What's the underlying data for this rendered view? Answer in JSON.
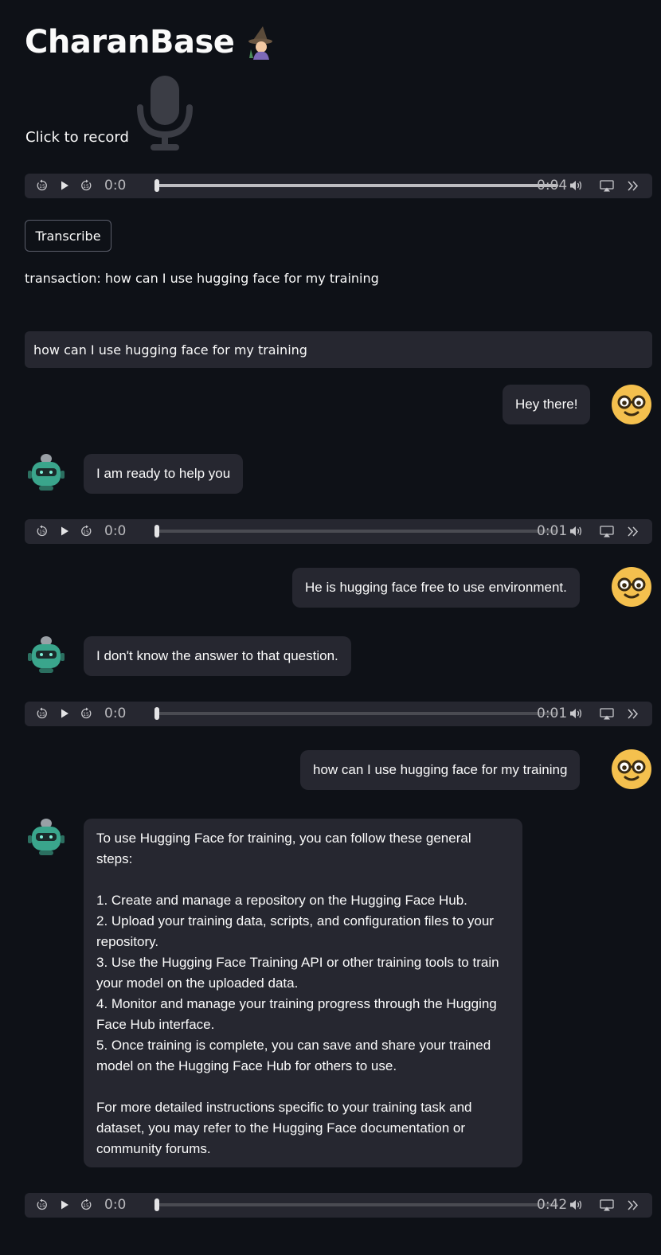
{
  "app": {
    "title": "CharanBase",
    "title_icon": "wizard-emoji-icon"
  },
  "recorder": {
    "label": "Click to record",
    "icon": "microphone-icon"
  },
  "audio_players": [
    {
      "current": "0:0",
      "duration": "0:04",
      "progress": 0.0
    },
    {
      "current": "0:0",
      "duration": "0:01",
      "progress": 0.0
    },
    {
      "current": "0:0",
      "duration": "0:01",
      "progress": 0.0
    },
    {
      "current": "0:0",
      "duration": "0:42",
      "progress": 0.0
    }
  ],
  "transcribe_button": {
    "label": "Transcribe"
  },
  "transcription": "transaction: how can I use hugging face for my training",
  "chat_input": {
    "value": "how can I use hugging face for my training"
  },
  "messages": [
    {
      "role": "user",
      "text": "Hey there!"
    },
    {
      "role": "assistant",
      "text": "I am ready to help you"
    },
    {
      "role": "user",
      "text": "He is hugging face free to use environment."
    },
    {
      "role": "assistant",
      "text": "I don't know the answer to that question."
    },
    {
      "role": "user",
      "text": "how can I use hugging face for my training"
    },
    {
      "role": "assistant",
      "text": "To use Hugging Face for training, you can follow these general steps:\n\n1. Create and manage a repository on the Hugging Face Hub.\n2. Upload your training data, scripts, and configuration files to your repository.\n3. Use the Hugging Face Training API or other training tools to train your model on the uploaded data.\n4. Monitor and manage your training progress through the Hugging Face Hub interface.\n5. Once training is complete, you can save and share your trained model on the Hugging Face Hub for others to use.\n\nFor more detailed instructions specific to your training task and dataset, you may refer to the Hugging Face documentation or community forums."
    }
  ],
  "colors": {
    "background": "#0e1117",
    "surface": "#262730",
    "text": "#fafafa",
    "user_avatar": "#f4c04e",
    "bot_avatar": "#3aa58c"
  }
}
